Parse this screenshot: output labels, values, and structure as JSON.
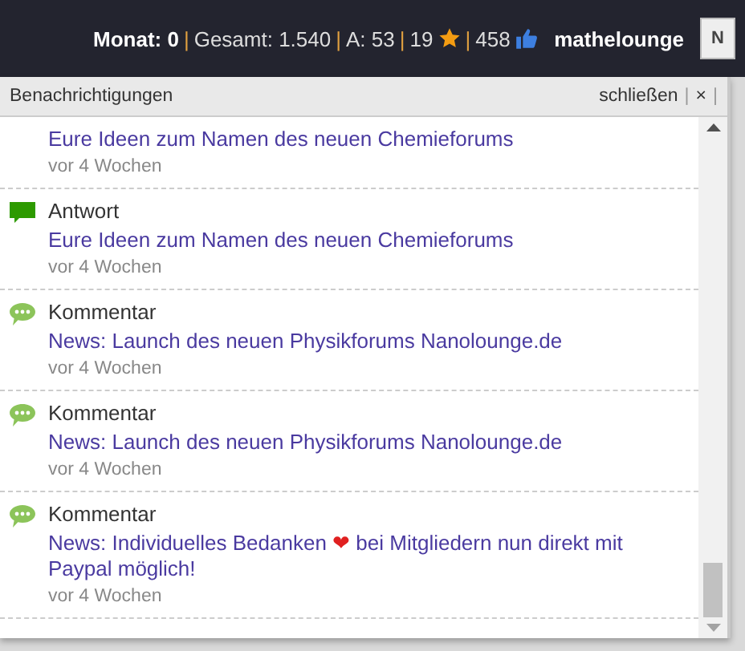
{
  "stats": {
    "month": "Monat: 0",
    "separator": "|",
    "total": "Gesamt: 1.540",
    "answers": "A: 53",
    "stars": "19",
    "likes": "458"
  },
  "user": {
    "name": "mathelounge",
    "avatar": "N"
  },
  "panel": {
    "title": "Benachrichtigungen",
    "close": "schließen",
    "separator": "|",
    "close_x": "×"
  },
  "notifications": [
    {
      "title": "Eure Ideen zum Namen des neuen Chemieforums",
      "time": "vor 4 Wochen"
    },
    {
      "kind": "answer",
      "type": "Antwort",
      "title": "Eure Ideen zum Namen des neuen Chemieforums",
      "time": "vor 4 Wochen"
    },
    {
      "kind": "comment",
      "type": "Kommentar",
      "title": "News: Launch des neuen Physikforums Nanolounge.de",
      "time": "vor 4 Wochen"
    },
    {
      "kind": "comment",
      "type": "Kommentar",
      "title": "News: Launch des neuen Physikforums Nanolounge.de",
      "time": "vor 4 Wochen"
    },
    {
      "kind": "comment",
      "type": "Kommentar",
      "title": "News: Individuelles Bedanken ❤ bei Mitgliedern nun direkt mit Paypal möglich!",
      "time": "vor 4 Wochen"
    }
  ]
}
